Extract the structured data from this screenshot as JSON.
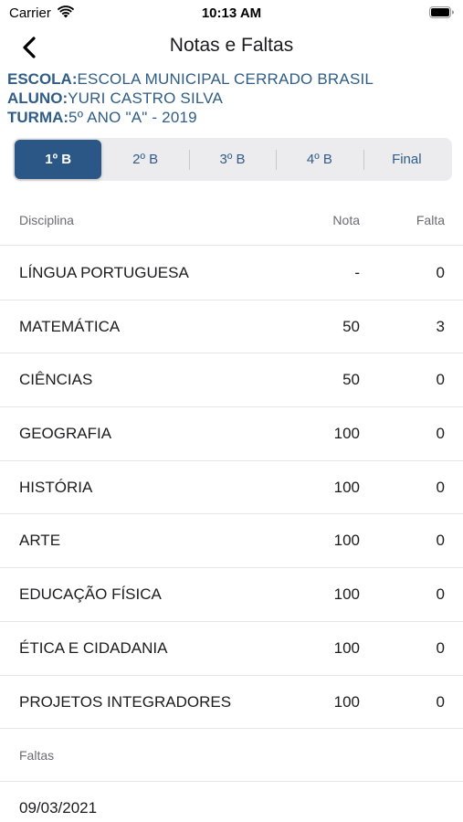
{
  "status_bar": {
    "carrier": "Carrier",
    "time": "10:13 AM"
  },
  "nav": {
    "title": "Notas e Faltas"
  },
  "info": {
    "escola_key": "ESCOLA:",
    "escola_value": "ESCOLA MUNICIPAL CERRADO BRASIL",
    "aluno_key": "ALUNO:",
    "aluno_value": "YURI CASTRO SILVA",
    "turma_key": "TURMA:",
    "turma_value": "5º ANO \"A\" - 2019"
  },
  "segments": [
    {
      "label": "1º B",
      "active": true
    },
    {
      "label": "2º B",
      "active": false
    },
    {
      "label": "3º B",
      "active": false
    },
    {
      "label": "4º B",
      "active": false
    },
    {
      "label": "Final",
      "active": false
    }
  ],
  "table": {
    "headers": {
      "disciplina": "Disciplina",
      "nota": "Nota",
      "falta": "Falta"
    },
    "rows": [
      {
        "disciplina": "LÍNGUA PORTUGUESA",
        "nota": "-",
        "falta": "0"
      },
      {
        "disciplina": "MATEMÁTICA",
        "nota": "50",
        "falta": "3"
      },
      {
        "disciplina": "CIÊNCIAS",
        "nota": "50",
        "falta": "0"
      },
      {
        "disciplina": "GEOGRAFIA",
        "nota": "100",
        "falta": "0"
      },
      {
        "disciplina": "HISTÓRIA",
        "nota": "100",
        "falta": "0"
      },
      {
        "disciplina": "ARTE",
        "nota": "100",
        "falta": "0"
      },
      {
        "disciplina": "EDUCAÇÃO FÍSICA",
        "nota": "100",
        "falta": "0"
      },
      {
        "disciplina": "ÉTICA E CIDADANIA",
        "nota": "100",
        "falta": "0"
      },
      {
        "disciplina": "PROJETOS INTEGRADORES",
        "nota": "100",
        "falta": "0"
      }
    ]
  },
  "faltas": {
    "header": "Faltas",
    "dates": [
      "09/03/2021"
    ]
  },
  "colors": {
    "accent": "#2a5785",
    "info_text": "#2f5d87"
  }
}
